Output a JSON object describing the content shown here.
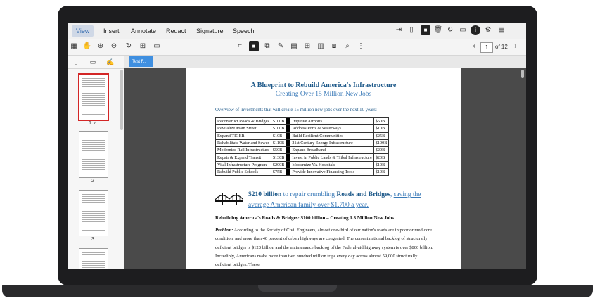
{
  "menu": {
    "items": [
      {
        "label": "View",
        "active": true
      },
      {
        "label": "Insert"
      },
      {
        "label": "Annotate"
      },
      {
        "label": "Redact"
      },
      {
        "label": "Signature"
      },
      {
        "label": "Speech"
      }
    ],
    "right_icons": [
      "export-icon",
      "file-icon",
      "dark-square-icon",
      "trash-icon",
      "sync-icon",
      "comment-icon",
      "info-icon",
      "gear-icon",
      "save-icon"
    ]
  },
  "toolbar": {
    "left_icons": [
      "panel-icon",
      "hand-icon",
      "zoom-in-icon",
      "zoom-out-icon",
      "rotate-icon",
      "insert-page-icon",
      "page-icon"
    ],
    "center_icons": [
      "crop-icon",
      "dark-square-icon",
      "copy-icon",
      "draw-icon",
      "page-view-icon",
      "grid-icon",
      "book-icon",
      "scan-icon",
      "search-icon",
      "more-icon"
    ],
    "current_page": "1",
    "page_total": "of 12"
  },
  "sidebar": {
    "tabs": [
      "layout-icon",
      "folder-icon",
      "annotation-icon"
    ],
    "thumbnails": [
      {
        "label": "1",
        "selected": true
      },
      {
        "label": "2"
      },
      {
        "label": "3"
      }
    ]
  },
  "document": {
    "tab_label": "Test F..",
    "title": "A Blueprint to Rebuild America's Infrastructure",
    "subtitle": "Creating Over 15 Million New Jobs",
    "overview": "Overview of investments that will create 15 million new jobs over the next 10 years:",
    "table": [
      [
        "Reconstruct Roads & Bridges",
        "$100B",
        "Improve Airports",
        "$50B"
      ],
      [
        "Revitalize Main Street",
        "$100B",
        "Address Ports & Waterways",
        "$10B"
      ],
      [
        "Expand TIGER",
        "$10B",
        "Build Resilient Communities",
        "$25B"
      ],
      [
        "Rehabilitate Water and Sewer",
        "$110B",
        "21st Century Energy Infrastructure",
        "$100B"
      ],
      [
        "Modernize Rail Infrastructure",
        "$50B",
        "Expand Broadband",
        "$20B"
      ],
      [
        "Repair & Expand Transit",
        "$130B",
        "Invest in Public Lands & Tribal Infrastructure",
        "$20B"
      ],
      [
        "Vital Infrastructure Program",
        "$200B",
        "Modernize VA Hospitals",
        "$10B"
      ],
      [
        "Rebuild Public Schools",
        "$75B",
        "Provide Innovative Financing Tools",
        "$10B"
      ]
    ],
    "headline_amount": "$210 billion",
    "headline_mid": " to repair crumbling ",
    "headline_bold": "Roads and Bridges",
    "headline_comma": ", ",
    "headline_link": "saving the average American family over $1,700 a year.",
    "section_heading": "Rebuilding America's Roads & Bridges: $100 billion – Creating 1.3 Million New Jobs",
    "problem_label": "Problem:",
    "problem_text": " According to the Society of Civil Engineers, almost one-third of our nation's roads are in poor or mediocre condition, and more than 40 percent of urban highways are congested. The current national backlog of structurally deficient bridges is $123 billion and the maintenance backlog of the Federal-aid highway system is over $800 billion. Incredibly, Americans make more than two hundred million trips every day across almost 59,000 structurally deficient bridges. These"
  }
}
